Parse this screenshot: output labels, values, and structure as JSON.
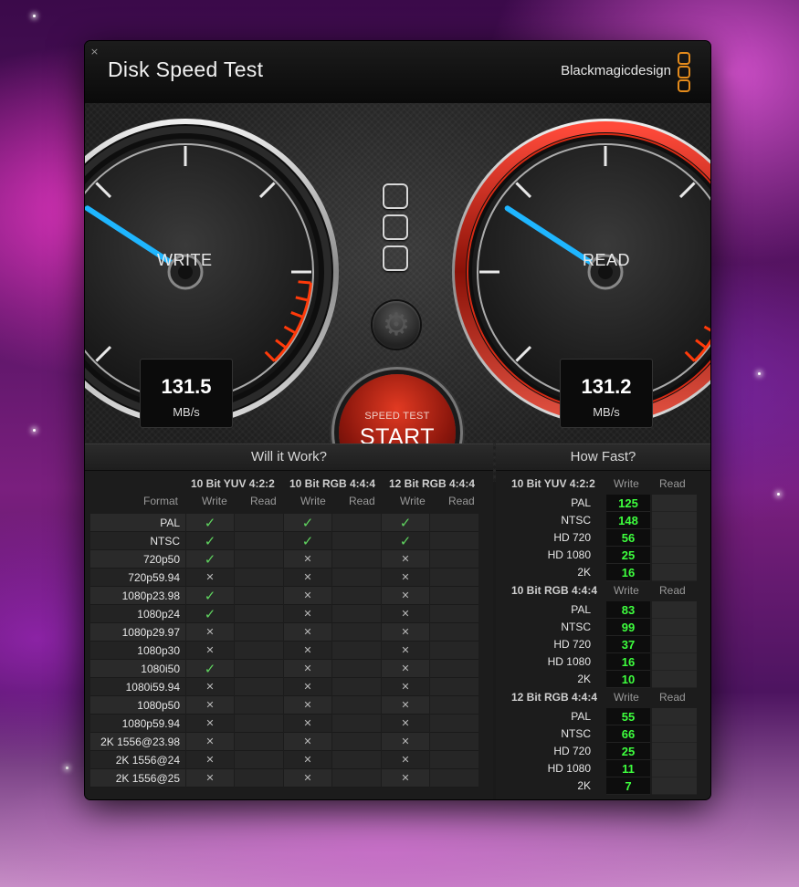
{
  "app": {
    "title": "Disk Speed Test",
    "brand": "Blackmagicdesign"
  },
  "gauges": {
    "write": {
      "label": "WRITE",
      "value": "131.5",
      "unit": "MB/s"
    },
    "read": {
      "label": "READ",
      "value": "131.2",
      "unit": "MB/s"
    }
  },
  "start": {
    "small": "SPEED TEST",
    "big": "START"
  },
  "will_it_work": {
    "title": "Will it Work?",
    "format_header": "Format",
    "groups": [
      "10 Bit YUV 4:2:2",
      "10 Bit RGB 4:4:4",
      "12 Bit RGB 4:4:4"
    ],
    "write_label": "Write",
    "read_label": "Read",
    "rows": [
      {
        "format": "PAL",
        "marks": [
          "ok",
          "ok",
          "ok"
        ]
      },
      {
        "format": "NTSC",
        "marks": [
          "ok",
          "ok",
          "ok"
        ]
      },
      {
        "format": "720p50",
        "marks": [
          "ok",
          "no",
          "no"
        ]
      },
      {
        "format": "720p59.94",
        "marks": [
          "no",
          "no",
          "no"
        ]
      },
      {
        "format": "1080p23.98",
        "marks": [
          "ok",
          "no",
          "no"
        ]
      },
      {
        "format": "1080p24",
        "marks": [
          "ok",
          "no",
          "no"
        ]
      },
      {
        "format": "1080p29.97",
        "marks": [
          "no",
          "no",
          "no"
        ]
      },
      {
        "format": "1080p30",
        "marks": [
          "no",
          "no",
          "no"
        ]
      },
      {
        "format": "1080i50",
        "marks": [
          "ok",
          "no",
          "no"
        ]
      },
      {
        "format": "1080i59.94",
        "marks": [
          "no",
          "no",
          "no"
        ]
      },
      {
        "format": "1080p50",
        "marks": [
          "no",
          "no",
          "no"
        ]
      },
      {
        "format": "1080p59.94",
        "marks": [
          "no",
          "no",
          "no"
        ]
      },
      {
        "format": "2K 1556@23.98",
        "marks": [
          "no",
          "no",
          "no"
        ]
      },
      {
        "format": "2K 1556@24",
        "marks": [
          "no",
          "no",
          "no"
        ]
      },
      {
        "format": "2K 1556@25",
        "marks": [
          "no",
          "no",
          "no"
        ]
      }
    ],
    "glyphs": {
      "ok": "✓",
      "no": "✕"
    }
  },
  "how_fast": {
    "title": "How Fast?",
    "write_label": "Write",
    "read_label": "Read",
    "sections": [
      {
        "name": "10 Bit YUV 4:2:2",
        "rows": [
          {
            "label": "PAL",
            "write": "125"
          },
          {
            "label": "NTSC",
            "write": "148"
          },
          {
            "label": "HD 720",
            "write": "56"
          },
          {
            "label": "HD 1080",
            "write": "25"
          },
          {
            "label": "2K",
            "write": "16"
          }
        ]
      },
      {
        "name": "10 Bit RGB 4:4:4",
        "rows": [
          {
            "label": "PAL",
            "write": "83"
          },
          {
            "label": "NTSC",
            "write": "99"
          },
          {
            "label": "HD 720",
            "write": "37"
          },
          {
            "label": "HD 1080",
            "write": "16"
          },
          {
            "label": "2K",
            "write": "10"
          }
        ]
      },
      {
        "name": "12 Bit RGB 4:4:4",
        "rows": [
          {
            "label": "PAL",
            "write": "55"
          },
          {
            "label": "NTSC",
            "write": "66"
          },
          {
            "label": "HD 720",
            "write": "25"
          },
          {
            "label": "HD 1080",
            "write": "11"
          },
          {
            "label": "2K",
            "write": "7"
          }
        ]
      }
    ]
  },
  "colors": {
    "accent_cyan": "#1fb6ff",
    "red_zone": "#ff3a0a",
    "ok_green": "#5fd35f",
    "value_green": "#3eff3e",
    "brand_orange": "#e48b1c"
  },
  "icons": {
    "close": "close-icon",
    "gear": "gear-icon",
    "logo": "blackmagic-logo-icon"
  }
}
